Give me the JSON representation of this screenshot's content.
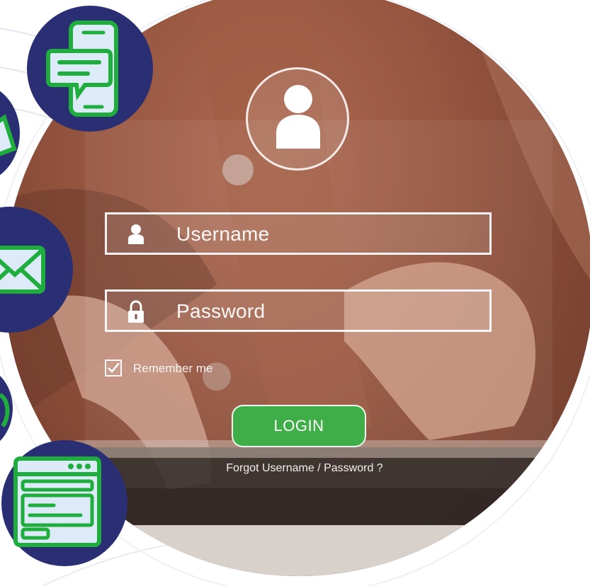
{
  "login_form": {
    "username_placeholder": "Username",
    "password_placeholder": "Password",
    "remember_label": "Remember me",
    "remember_checked": true,
    "login_label": "LOGIN",
    "forgot_link": "Forgot Username / Password ?"
  },
  "side_icons": [
    "chat-phone-icon",
    "partial-icon",
    "mail-icon",
    "partial-icon",
    "browser-window-icon"
  ],
  "colors": {
    "badge_navy": "#2a2f74",
    "icon_green": "#1fae3e",
    "icon_fill": "#ddeaf7",
    "login_green": "#3fae49"
  }
}
